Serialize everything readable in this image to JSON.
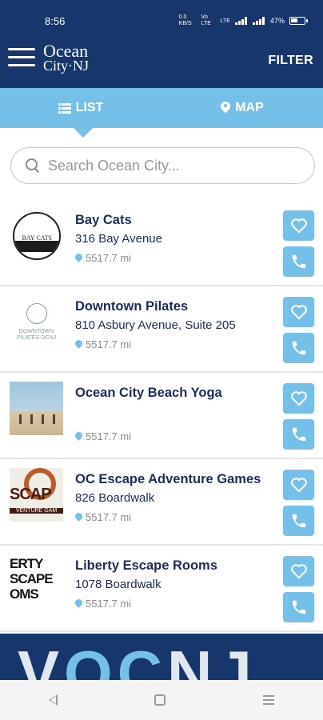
{
  "status_bar": {
    "time": "8:56",
    "net_left": "0.0 KB/S",
    "volte": "Vo LTE",
    "lte": "LTE",
    "battery_pct": "47%"
  },
  "header": {
    "logo_line1": "Ocean",
    "logo_line2": "City·NJ",
    "filter_label": "FILTER"
  },
  "tabs": {
    "list_label": "LIST",
    "map_label": "MAP",
    "active": "list"
  },
  "search": {
    "placeholder": "Search Ocean City..."
  },
  "listings": [
    {
      "name": "Bay Cats",
      "address": "316 Bay Avenue",
      "distance": "5517.7 mi",
      "thumb_text": "BAY CATS"
    },
    {
      "name": "Downtown Pilates",
      "address": "810 Asbury Avenue, Suite 205",
      "distance": "5517.7 mi",
      "thumb_text": "DOWNTOWN PILATES OCNJ"
    },
    {
      "name": "Ocean City Beach Yoga",
      "address": "",
      "distance": "5517.7 mi"
    },
    {
      "name": "OC Escape Adventure Games",
      "address": "826 Boardwalk",
      "distance": "5517.7 mi",
      "thumb_text": "SCAP",
      "thumb_sub": "VENTURE GAM"
    },
    {
      "name": "Liberty Escape Rooms",
      "address": "1078 Boardwalk",
      "distance": "5517.7 mi",
      "thumb_text": "ERTY SCAPE OMS"
    }
  ],
  "banner": {
    "text_part1": "V",
    "text_part2": "OC",
    "text_part3": "NJ"
  },
  "colors": {
    "navy": "#17366b",
    "light_blue": "#74c0e8",
    "text_navy": "#1a2d5c"
  },
  "icons": [
    "menu-icon",
    "list-icon",
    "map-pin-icon",
    "search-icon",
    "heart-icon",
    "phone-icon",
    "location-pin-icon",
    "back-icon",
    "home-icon",
    "recents-icon"
  ]
}
